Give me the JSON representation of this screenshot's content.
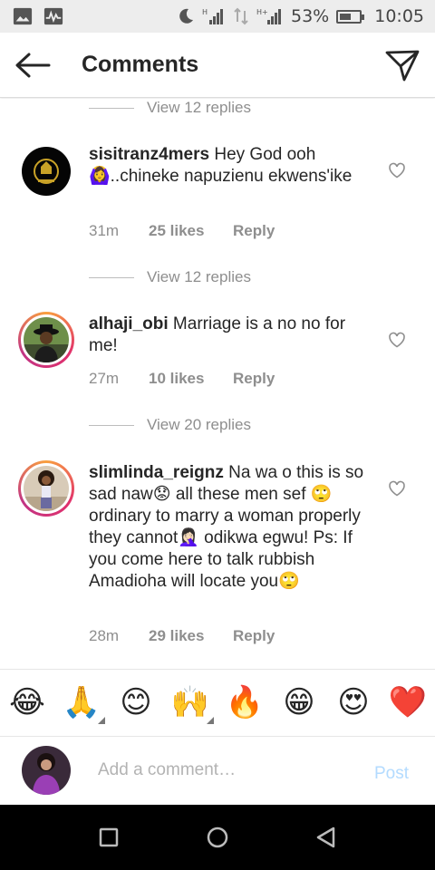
{
  "status_bar": {
    "battery": "53%",
    "time": "10:05",
    "battery_level": 0.53,
    "icons": [
      "image-icon",
      "activity-icon",
      "moon-icon",
      "signal-icon",
      "data-arrows-icon",
      "signal-h-plus-icon",
      "battery-icon"
    ]
  },
  "header": {
    "title": "Comments",
    "back_icon": "arrow-left-icon",
    "send_icon": "paper-plane-icon"
  },
  "comments": {
    "top_view_replies": "View 12 replies",
    "items": [
      {
        "username": "sisitranz4mers",
        "text": "Hey God ooh🙆‍♀️..chineke napuzienu ekwens'ike",
        "time": "31m",
        "likes": "25 likes",
        "reply": "Reply",
        "view_replies": "View 12 replies"
      },
      {
        "username": "alhaji_obi",
        "text": "Marriage is a no no for me!",
        "time": "27m",
        "likes": "10 likes",
        "reply": "Reply",
        "view_replies": "View 20 replies"
      },
      {
        "username": "slimlinda_reignz",
        "text": "Na wa o this is so sad naw😟 all these men sef 🙄 ordinary to marry a woman properly they cannot🤦🏻‍♀️ odikwa egwu! Ps: If you come here to talk rubbish Amadioha will locate you🙄",
        "time": "28m",
        "likes": "29 likes",
        "reply": "Reply"
      }
    ]
  },
  "emoji_bar": [
    "😂",
    "🙏",
    "😊",
    "🙌",
    "🔥",
    "😁",
    "😍",
    "❤️"
  ],
  "composer": {
    "placeholder": "Add a comment…",
    "post_label": "Post"
  },
  "colors": {
    "post_disabled": "#b3dbff",
    "meta_gray": "#8e8e8e",
    "story_ring_start": "#f9a03f",
    "story_ring_end": "#c13584"
  }
}
